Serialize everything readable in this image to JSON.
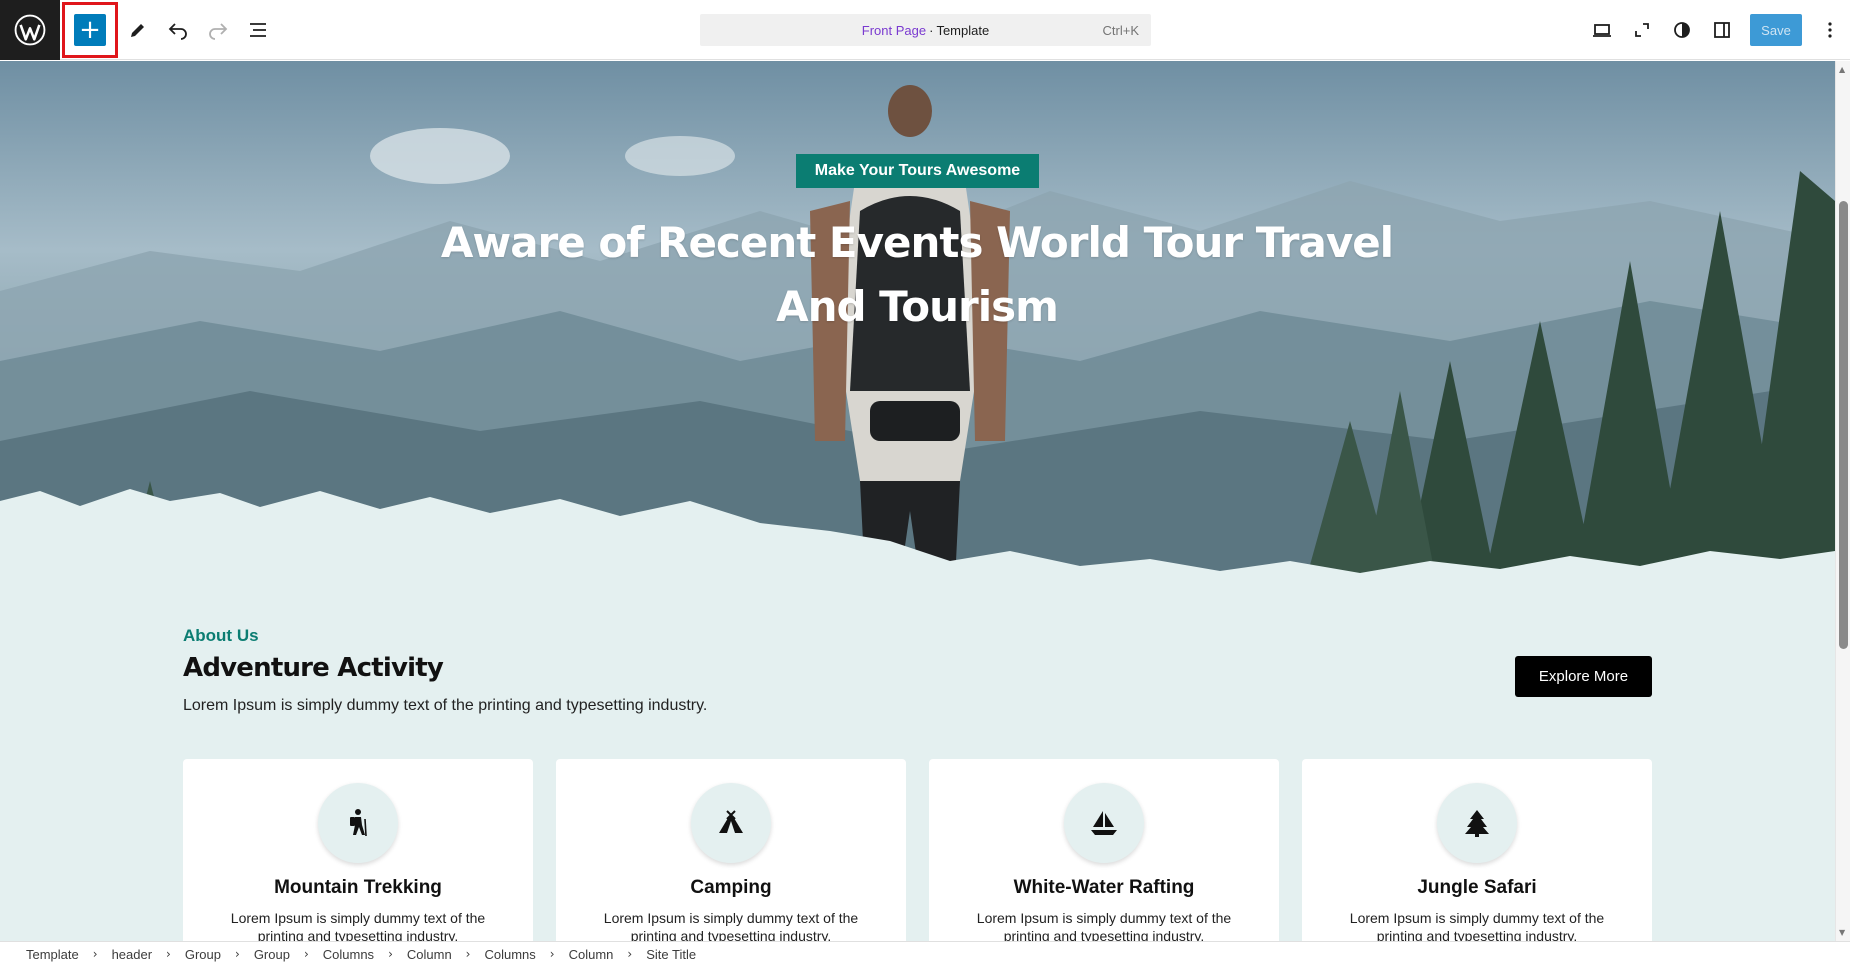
{
  "toolbar": {
    "add_label": "+",
    "document": {
      "name": "Front Page",
      "separator": "·",
      "type": "Template",
      "shortcut": "Ctrl+K"
    },
    "save_label": "Save",
    "accent_color": "#007cba"
  },
  "hero": {
    "badge": "Make Your Tours Awesome",
    "title": "Aware of Recent Events World Tour Travel And Tourism"
  },
  "about": {
    "label": "About Us",
    "title": "Adventure Activity",
    "description": "Lorem Ipsum is simply dummy text of the printing and typesetting industry.",
    "button": "Explore More"
  },
  "cards": [
    {
      "icon": "hiking-icon",
      "title": "Mountain Trekking",
      "description": "Lorem Ipsum is simply dummy text of the printing and typesetting industry."
    },
    {
      "icon": "tent-icon",
      "title": "Camping",
      "description": "Lorem Ipsum is simply dummy text of the printing and typesetting industry."
    },
    {
      "icon": "sailboat-icon",
      "title": "White-Water Rafting",
      "description": "Lorem Ipsum is simply dummy text of the printing and typesetting industry."
    },
    {
      "icon": "tree-icon",
      "title": "Jungle Safari",
      "description": "Lorem Ipsum is simply dummy text of the printing and typesetting industry."
    }
  ],
  "breadcrumb": [
    "Template",
    "header",
    "Group",
    "Group",
    "Columns",
    "Column",
    "Columns",
    "Column",
    "Site Title"
  ],
  "colors": {
    "brand_teal": "#0b7d72",
    "canvas_bg": "#e4f0f0"
  }
}
